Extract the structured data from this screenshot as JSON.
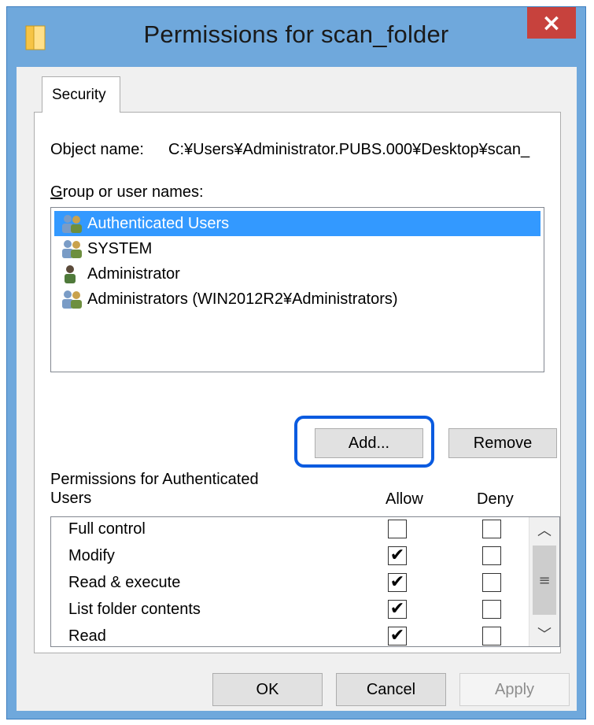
{
  "window": {
    "title": "Permissions for scan_folder",
    "close_label": "×",
    "icon": "folder-icon"
  },
  "tabs": [
    {
      "label": "Security",
      "active": true
    }
  ],
  "object_name": {
    "label": "Object name:",
    "value": "C:¥Users¥Administrator.PUBS.000¥Desktop¥scan_"
  },
  "groups": {
    "label": "Group or user names:",
    "items": [
      {
        "label": "Authenticated Users",
        "icon": "users-group-icon",
        "selected": true
      },
      {
        "label": "SYSTEM",
        "icon": "users-group-icon",
        "selected": false
      },
      {
        "label": "Administrator",
        "icon": "user-icon",
        "selected": false
      },
      {
        "label": "Administrators (WIN2012R2¥Administrators)",
        "icon": "users-group-icon",
        "selected": false
      }
    ]
  },
  "buttons": {
    "add": "Add...",
    "remove": "Remove",
    "ok": "OK",
    "cancel": "Cancel",
    "apply": "Apply"
  },
  "permissions": {
    "label": "Permissions for Authenticated Users",
    "allow_header": "Allow",
    "deny_header": "Deny",
    "items": [
      {
        "name": "Full control",
        "allow": false,
        "deny": false
      },
      {
        "name": "Modify",
        "allow": true,
        "deny": false
      },
      {
        "name": "Read & execute",
        "allow": true,
        "deny": false
      },
      {
        "name": "List folder contents",
        "allow": true,
        "deny": false
      },
      {
        "name": "Read",
        "allow": true,
        "deny": false
      }
    ]
  },
  "colors": {
    "title_bar": "#6fa8dc",
    "close_button": "#c7423d",
    "selection": "#3399ff",
    "highlight_outline": "#0a5be0"
  }
}
